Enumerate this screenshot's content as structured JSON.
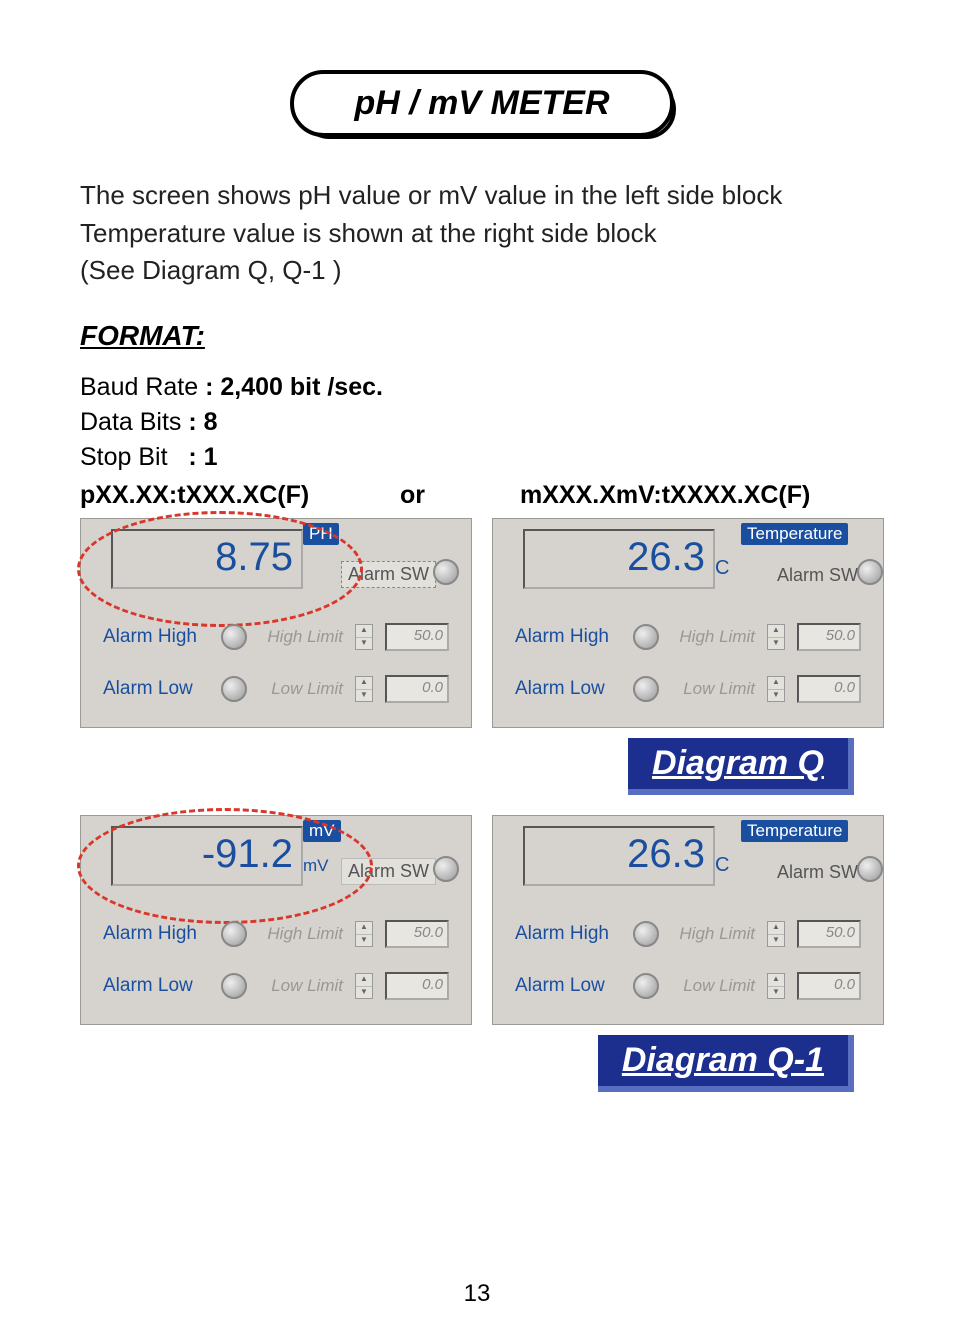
{
  "title": "pH / mV METER",
  "intro_line1": "The screen shows pH value or mV value in the left side block",
  "intro_line2": "Temperature value is shown at the right side block",
  "intro_line3": "(See Diagram Q, Q-1 )",
  "format_heading": "FORMAT:",
  "specs": {
    "baud_label": "Baud Rate",
    "baud_value": ": 2,400 bit /sec.",
    "data_bits_label": "Data Bits",
    "data_bits_value": ": 8",
    "stop_bit_label": "Stop Bit",
    "stop_bit_value": ": 1"
  },
  "fmt_left": "pXX.XX:tXXX.XC(F)",
  "fmt_or": "or",
  "fmt_right": "mXXX.XmV:tXXXX.XC(F)",
  "diagram_q_label": "Diagram Q",
  "diagram_q1_label": "Diagram Q-1",
  "panels": {
    "ph": {
      "value": "8.75",
      "unit_badge": "PH",
      "alarm_sw": "Alarm SW",
      "alarm_high": "Alarm High",
      "alarm_low": "Alarm Low",
      "high_limit_label": "High Limit",
      "low_limit_label": "Low Limit",
      "high_limit_value": "50.0",
      "low_limit_value": "0.0"
    },
    "temp_q": {
      "value": "26.3",
      "unit_badge": "Temperature",
      "unit_c": "C",
      "alarm_sw": "Alarm SW",
      "alarm_high": "Alarm High",
      "alarm_low": "Alarm Low",
      "high_limit_label": "High Limit",
      "low_limit_label": "Low Limit",
      "high_limit_value": "50.0",
      "low_limit_value": "0.0"
    },
    "mv": {
      "value": "-91.2",
      "unit_badge": "mV",
      "unit_sub": "mV",
      "alarm_sw": "Alarm SW",
      "alarm_high": "Alarm High",
      "alarm_low": "Alarm Low",
      "high_limit_label": "High Limit",
      "low_limit_label": "Low Limit",
      "high_limit_value": "50.0",
      "low_limit_value": "0.0"
    },
    "temp_q1": {
      "value": "26.3",
      "unit_badge": "Temperature",
      "unit_c": "C",
      "alarm_sw": "Alarm SW",
      "alarm_high": "Alarm High",
      "alarm_low": "Alarm Low",
      "high_limit_label": "High Limit",
      "low_limit_label": "Low Limit",
      "high_limit_value": "50.0",
      "low_limit_value": "0.0"
    }
  },
  "page_number": "13"
}
